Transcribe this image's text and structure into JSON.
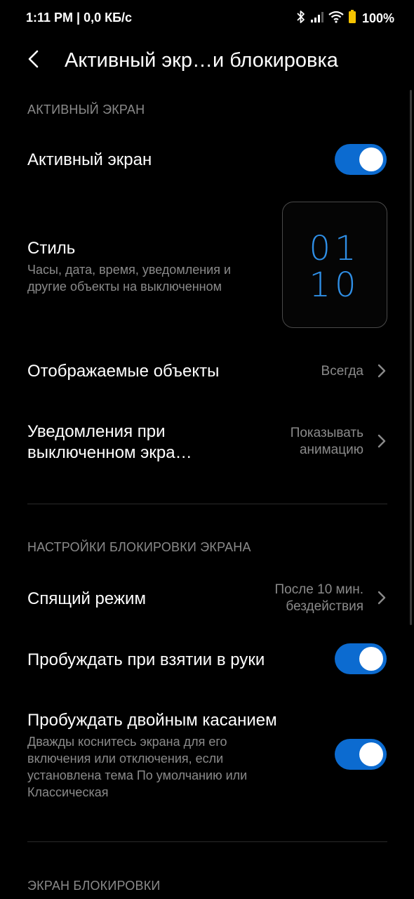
{
  "status_bar": {
    "time_speed": "1:11 PM | 0,0 КБ/с",
    "battery": "100%"
  },
  "header": {
    "title": "Активный экр…и блокировка"
  },
  "sections": {
    "aod_header": "АКТИВНЫЙ ЭКРАН",
    "lock_settings_header": "НАСТРОЙКИ БЛОКИРОВКИ ЭКРАНА",
    "lock_screen_header": "ЭКРАН БЛОКИРОВКИ"
  },
  "rows": {
    "aod": {
      "title": "Активный экран",
      "enabled": true
    },
    "style": {
      "title": "Стиль",
      "subtitle_line1": "Часы, дата, время, уведомления и",
      "subtitle_line2": "другие объекты на выключенном",
      "preview_line1": "01",
      "preview_line2": "10"
    },
    "items": {
      "title": "Отображаемые объекты",
      "value": "Всегда"
    },
    "notifications": {
      "title_line1": "Уведомления при",
      "title_line2": "выключенном экра…",
      "value_line1": "Показывать",
      "value_line2": "анимацию"
    },
    "sleep": {
      "title": "Спящий режим",
      "value_line1": "После 10 мин.",
      "value_line2": "бездействия"
    },
    "raise_to_wake": {
      "title": "Пробуждать при взятии в руки",
      "enabled": true
    },
    "double_tap": {
      "title": "Пробуждать двойным касанием",
      "subtitle_line1": "Дважды коснитесь экрана для его",
      "subtitle_line2": "включения или отключения, если",
      "subtitle_line3": "установлена тема По умолчанию или",
      "subtitle_line4": "Классическая",
      "enabled": true
    }
  },
  "colors": {
    "accent": "#0c6bd0",
    "preview_digits": "#2f8fe6",
    "secondary_text": "#8a8a8a"
  }
}
